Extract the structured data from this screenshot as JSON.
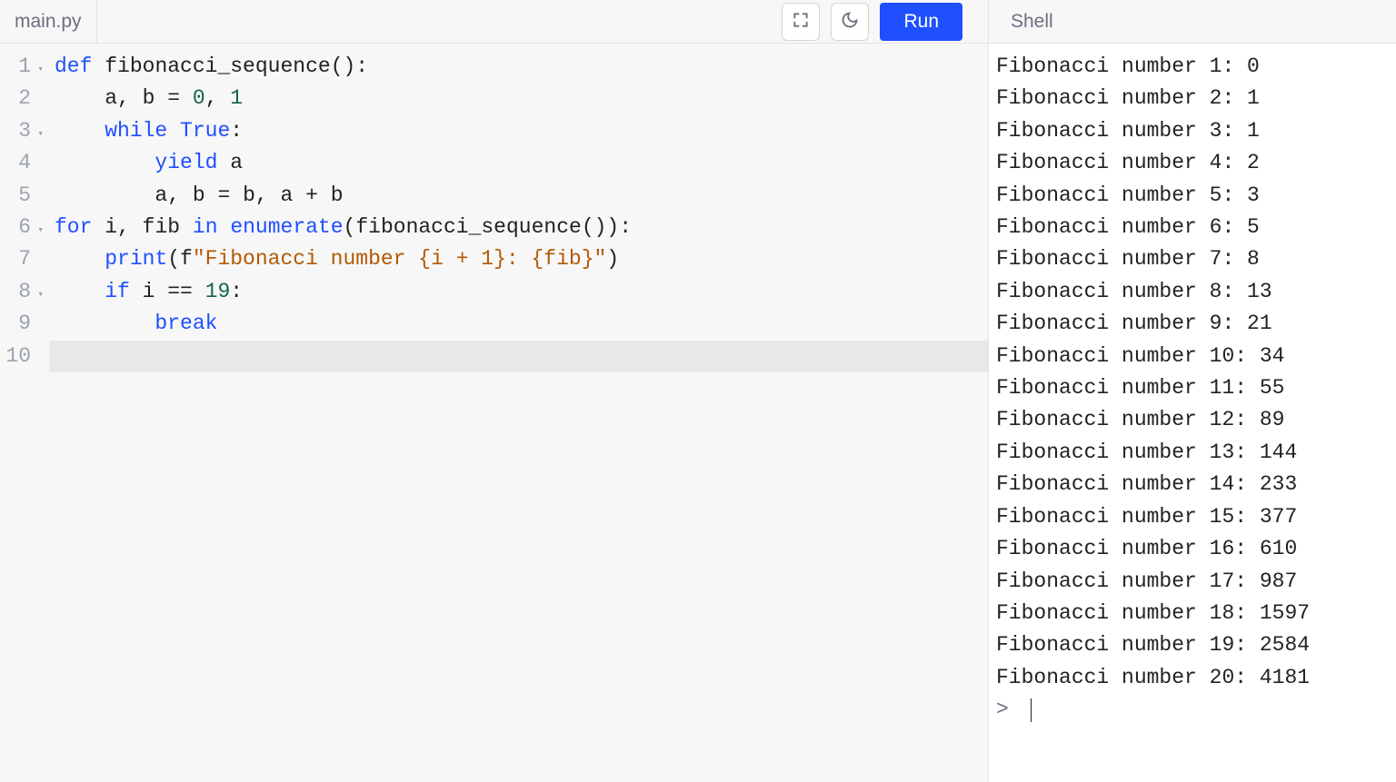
{
  "header": {
    "file_tab": "main.py",
    "run_label": "Run",
    "shell_tab": "Shell",
    "fullscreen_icon": "fullscreen-icon",
    "theme_icon": "moon-icon"
  },
  "editor": {
    "active_line": 10,
    "lines": [
      {
        "num": 1,
        "fold": true,
        "indent": 0,
        "tokens": [
          {
            "t": "kw",
            "v": "def"
          },
          {
            "t": "sp",
            "v": " "
          },
          {
            "t": "ident",
            "v": "fibonacci_sequence"
          },
          {
            "t": "op",
            "v": "():"
          }
        ]
      },
      {
        "num": 2,
        "fold": false,
        "indent": 1,
        "tokens": [
          {
            "t": "ident",
            "v": "a"
          },
          {
            "t": "op",
            "v": ", "
          },
          {
            "t": "ident",
            "v": "b"
          },
          {
            "t": "op",
            "v": " = "
          },
          {
            "t": "num",
            "v": "0"
          },
          {
            "t": "op",
            "v": ", "
          },
          {
            "t": "num",
            "v": "1"
          }
        ]
      },
      {
        "num": 3,
        "fold": true,
        "indent": 1,
        "tokens": [
          {
            "t": "kw",
            "v": "while"
          },
          {
            "t": "sp",
            "v": " "
          },
          {
            "t": "builtin",
            "v": "True"
          },
          {
            "t": "op",
            "v": ":"
          }
        ]
      },
      {
        "num": 4,
        "fold": false,
        "indent": 2,
        "tokens": [
          {
            "t": "kw",
            "v": "yield"
          },
          {
            "t": "sp",
            "v": " "
          },
          {
            "t": "ident",
            "v": "a"
          }
        ]
      },
      {
        "num": 5,
        "fold": false,
        "indent": 2,
        "tokens": [
          {
            "t": "ident",
            "v": "a"
          },
          {
            "t": "op",
            "v": ", "
          },
          {
            "t": "ident",
            "v": "b"
          },
          {
            "t": "op",
            "v": " = "
          },
          {
            "t": "ident",
            "v": "b"
          },
          {
            "t": "op",
            "v": ", "
          },
          {
            "t": "ident",
            "v": "a"
          },
          {
            "t": "op",
            "v": " + "
          },
          {
            "t": "ident",
            "v": "b"
          }
        ]
      },
      {
        "num": 6,
        "fold": true,
        "indent": 0,
        "tokens": [
          {
            "t": "kw",
            "v": "for"
          },
          {
            "t": "sp",
            "v": " "
          },
          {
            "t": "ident",
            "v": "i"
          },
          {
            "t": "op",
            "v": ", "
          },
          {
            "t": "ident",
            "v": "fib"
          },
          {
            "t": "sp",
            "v": " "
          },
          {
            "t": "kw",
            "v": "in"
          },
          {
            "t": "sp",
            "v": " "
          },
          {
            "t": "builtin",
            "v": "enumerate"
          },
          {
            "t": "op",
            "v": "("
          },
          {
            "t": "ident",
            "v": "fibonacci_sequence"
          },
          {
            "t": "op",
            "v": "()):"
          }
        ]
      },
      {
        "num": 7,
        "fold": false,
        "indent": 1,
        "tokens": [
          {
            "t": "builtin",
            "v": "print"
          },
          {
            "t": "op",
            "v": "(f"
          },
          {
            "t": "str",
            "v": "\"Fibonacci number {i + 1}: {fib}\""
          },
          {
            "t": "op",
            "v": ")"
          }
        ]
      },
      {
        "num": 8,
        "fold": true,
        "indent": 1,
        "tokens": [
          {
            "t": "kw",
            "v": "if"
          },
          {
            "t": "sp",
            "v": " "
          },
          {
            "t": "ident",
            "v": "i"
          },
          {
            "t": "op",
            "v": " == "
          },
          {
            "t": "num",
            "v": "19"
          },
          {
            "t": "op",
            "v": ":"
          }
        ]
      },
      {
        "num": 9,
        "fold": false,
        "indent": 2,
        "tokens": [
          {
            "t": "kw",
            "v": "break"
          }
        ]
      },
      {
        "num": 10,
        "fold": false,
        "indent": 0,
        "tokens": []
      }
    ]
  },
  "shell": {
    "output_lines": [
      "Fibonacci number 1: 0",
      "Fibonacci number 2: 1",
      "Fibonacci number 3: 1",
      "Fibonacci number 4: 2",
      "Fibonacci number 5: 3",
      "Fibonacci number 6: 5",
      "Fibonacci number 7: 8",
      "Fibonacci number 8: 13",
      "Fibonacci number 9: 21",
      "Fibonacci number 10: 34",
      "Fibonacci number 11: 55",
      "Fibonacci number 12: 89",
      "Fibonacci number 13: 144",
      "Fibonacci number 14: 233",
      "Fibonacci number 15: 377",
      "Fibonacci number 16: 610",
      "Fibonacci number 17: 987",
      "Fibonacci number 18: 1597",
      "Fibonacci number 19: 2584",
      "Fibonacci number 20: 4181"
    ],
    "prompt": ">"
  }
}
